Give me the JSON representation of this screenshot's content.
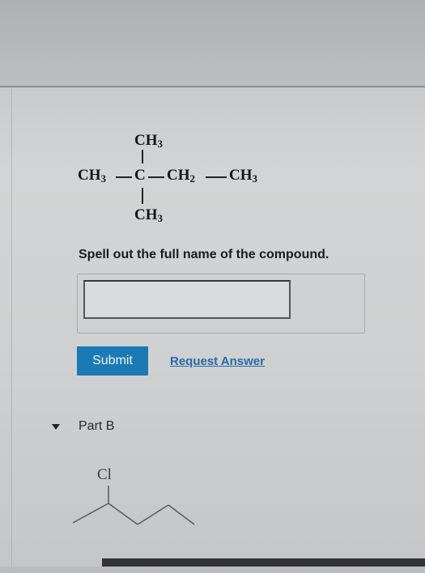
{
  "molecule": {
    "top_group": "CH",
    "top_sub": "3",
    "left_group": "CH",
    "left_sub": "3",
    "center_atom": "C",
    "right_group1": "CH",
    "right_group1_sub": "2",
    "right_group2": "CH",
    "right_group2_sub": "3",
    "bottom_group": "CH",
    "bottom_sub": "3"
  },
  "question": {
    "prompt": "Spell out the full name of the compound.",
    "answer_value": "",
    "submit_label": "Submit",
    "request_answer_label": "Request Answer"
  },
  "part_b": {
    "label": "Part B",
    "atom_label": "Cl"
  }
}
